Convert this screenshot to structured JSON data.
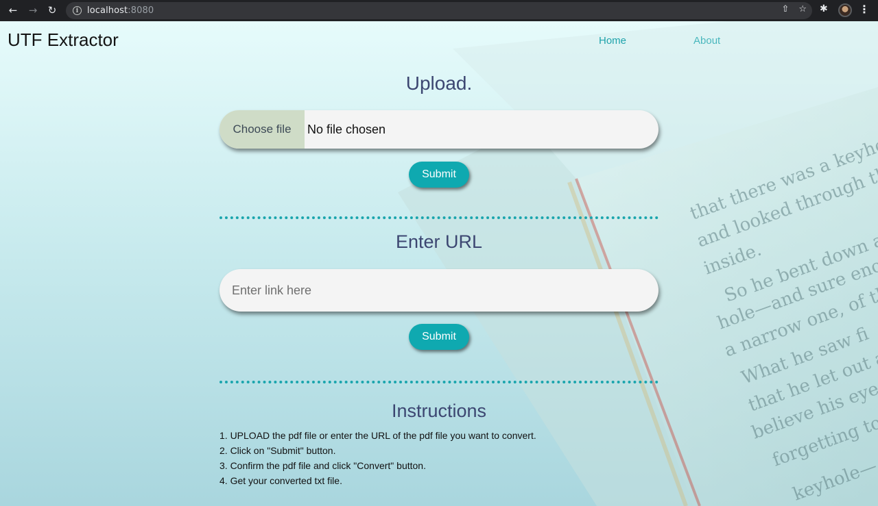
{
  "browser": {
    "url_host": "localhost",
    "url_port": ":8080"
  },
  "header": {
    "brand": "UTF Extractor",
    "nav": [
      "Home",
      "About"
    ]
  },
  "upload": {
    "title": "Upload.",
    "choose_label": "Choose file",
    "file_status": "No file chosen",
    "submit_label": "Submit"
  },
  "url_section": {
    "title": "Enter URL",
    "placeholder": "Enter link here",
    "submit_label": "Submit"
  },
  "instructions": {
    "title": "Instructions",
    "steps": [
      "1. UPLOAD the pdf file or enter the URL of the pdf file you want to convert.",
      "2. Click on \"Submit\" button.",
      "3. Confirm the pdf file and click \"Convert\" button.",
      "4. Get your converted txt file."
    ]
  },
  "colors": {
    "accent": "#0fa9b0",
    "title": "#3c4671",
    "nav": "#1ea3ab"
  }
}
